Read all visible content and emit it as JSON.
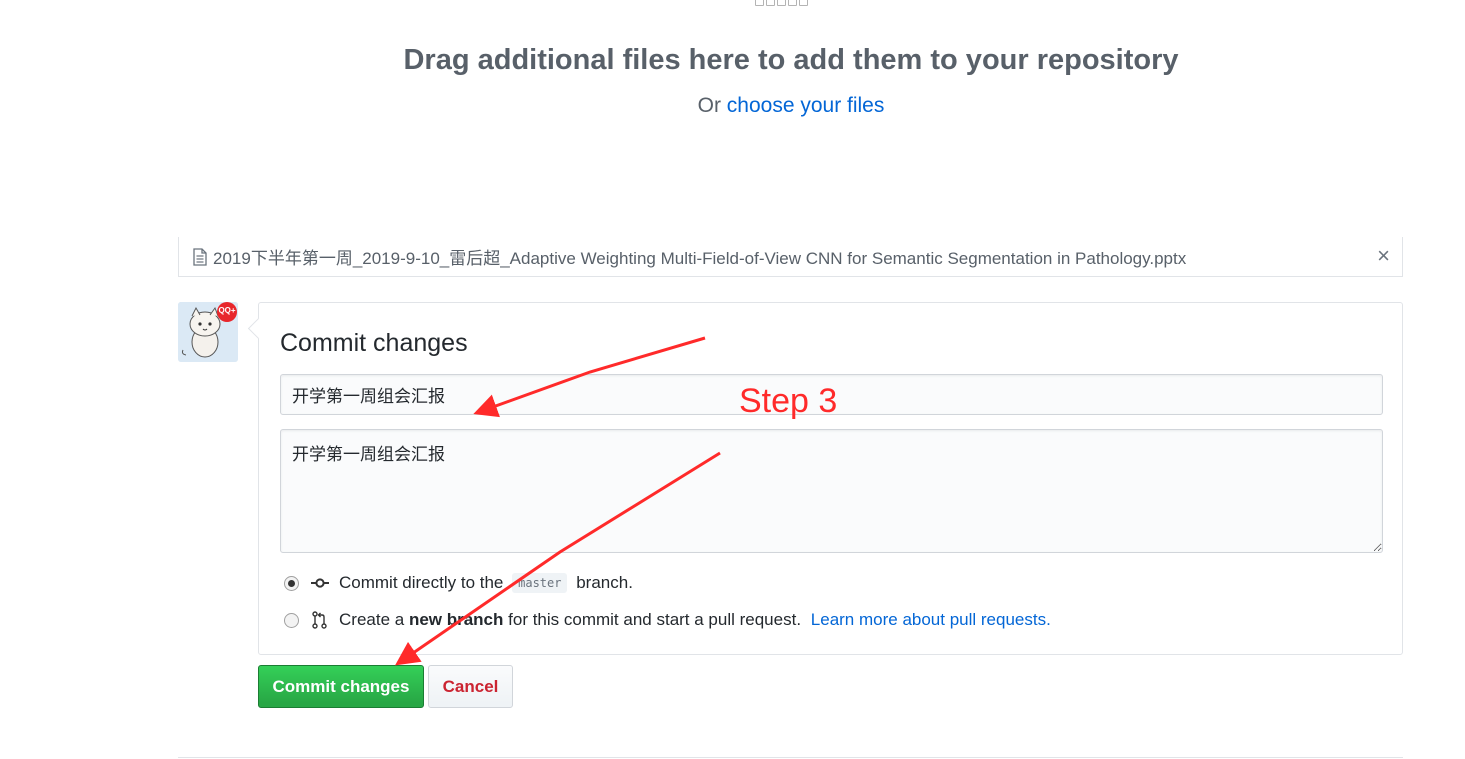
{
  "dropzone": {
    "title": "Drag additional files here to add them to your repository",
    "or_text": "Or",
    "choose_link": "choose your files"
  },
  "file": {
    "name": "2019下半年第一周_2019-9-10_雷后超_Adaptive Weighting Multi-Field-of-View CNN for Semantic Segmentation in Pathology.pptx",
    "remove_label": "×",
    "icon": "file-icon"
  },
  "avatar": {
    "badge_text": "QQ+"
  },
  "commit": {
    "title": "Commit changes",
    "summary_value": "开学第一周组会汇报",
    "description_value": "开学第一周组会汇报",
    "option_direct": {
      "text_before": "Commit directly to the",
      "branch": "master",
      "text_after": "branch.",
      "selected": true,
      "icon": "git-commit-icon"
    },
    "option_new_branch": {
      "text_before": "Create a",
      "bold": "new branch",
      "text_after": "for this commit and start a pull request.",
      "link": "Learn more about pull requests.",
      "selected": false,
      "icon": "git-pull-request-icon"
    }
  },
  "buttons": {
    "commit": "Commit changes",
    "cancel": "Cancel"
  },
  "annotation": {
    "label": "Step 3",
    "color": "#ff2a2a"
  },
  "colors": {
    "link": "#0366d6",
    "primary_button": "#28a745",
    "danger_text": "#cb2431"
  }
}
